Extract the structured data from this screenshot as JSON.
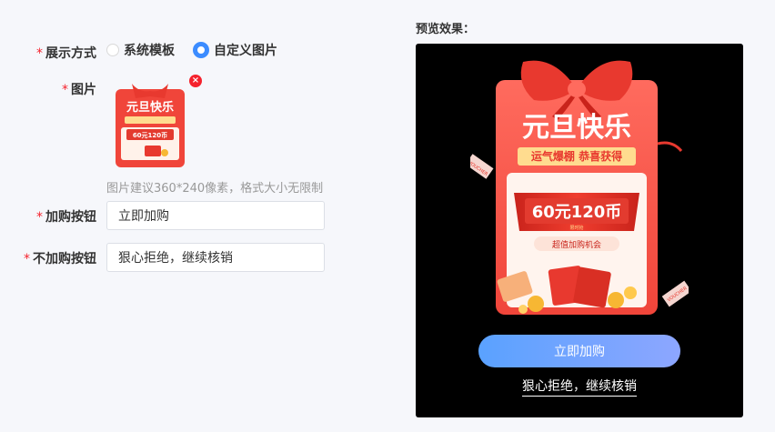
{
  "form": {
    "display_mode": {
      "label": "展示方式",
      "options": [
        "系统模板",
        "自定义图片"
      ],
      "selected": "自定义图片"
    },
    "image": {
      "label": "图片",
      "hint": "图片建议360*240像素，格式大小无限制"
    },
    "buy_button": {
      "label": "加购按钮",
      "value": "立即加购"
    },
    "decline_button": {
      "label": "不加购按钮",
      "value": "狠心拒绝，继续核销"
    }
  },
  "preview": {
    "title": "预览效果：",
    "poster": {
      "headline": "元旦快乐",
      "subline": "运气爆棚 恭喜获得",
      "prize": "60元120币",
      "prize_note": "限时抢",
      "offer": "超值加购机会",
      "ribbon_left": "VOUCHER",
      "ribbon_right": "VOUCHER"
    },
    "buy_label": "立即加购",
    "decline_label": "狠心拒绝，继续核销"
  },
  "colors": {
    "accent": "#3c8cff",
    "required": "#f5222d",
    "poster_red": "#f0453a"
  }
}
